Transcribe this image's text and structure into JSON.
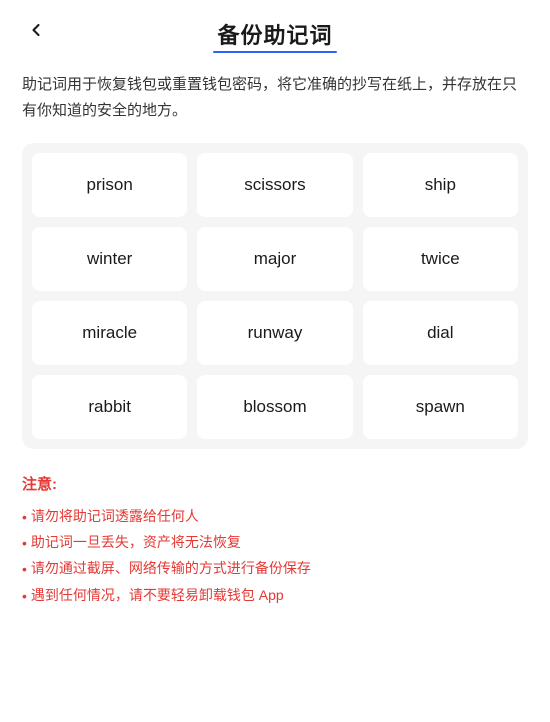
{
  "header": {
    "title": "备份助记词",
    "back_label": "返回"
  },
  "description": "助记词用于恢复钱包或重置钱包密码，将它准确的抄写在纸上，并存放在只有你知道的安全的地方。",
  "mnemonic": {
    "words": [
      "prison",
      "scissors",
      "ship",
      "winter",
      "major",
      "twice",
      "miracle",
      "runway",
      "dial",
      "rabbit",
      "blossom",
      "spawn"
    ]
  },
  "notice": {
    "title": "注意:",
    "items": [
      "请勿将助记词透露给任何人",
      "助记词一旦丢失，资产将无法恢复",
      "请勿通过截屏、网络传输的方式进行备份保存",
      "遇到任何情况，请不要轻易卸载钱包 App"
    ],
    "bullet": "•"
  }
}
